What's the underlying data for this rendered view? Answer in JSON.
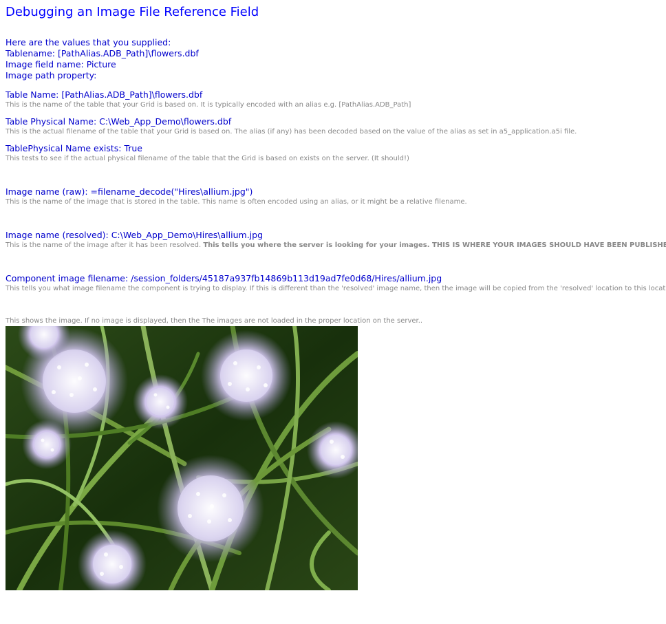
{
  "page": {
    "title": "Debugging an Image File Reference Field"
  },
  "supplied": {
    "intro": "Here are the values that you supplied:",
    "tablename": "Tablename: [PathAlias.ADB_Path]\\flowers.dbf",
    "image_field": "Image field name: Picture",
    "image_path_property": "Image path property:"
  },
  "table_name": {
    "label": "Table Name: [PathAlias.ADB_Path]\\flowers.dbf",
    "note": "This is the name of the table that your Grid is based on. It is typically encoded with an alias e.g. [PathAlias.ADB_Path]"
  },
  "table_physical_name": {
    "label": "Table Physical Name: C:\\Web_App_Demo\\flowers.dbf",
    "note": "This is the actual filename of the table that your Grid is based on. The alias (if any) has been decoded based on the value of the alias as set in a5_application.a5i file."
  },
  "physical_exists": {
    "label": "TablePhysical Name exists: True",
    "note": "This tests to see if the actual physical filename of the table that the Grid is based on exists on the server. (It should!)"
  },
  "image_raw": {
    "label": "Image name (raw): =filename_decode(\"Hires\\allium.jpg\")",
    "note": "This is the name of the image that is stored in the table. This name is often encoded using an alias, or it might be a relative filename."
  },
  "image_resolved": {
    "label": "Image name (resolved): C:\\Web_App_Demo\\Hires\\allium.jpg",
    "note_plain": "This is the name of the image after it has been resolved. ",
    "note_bold": "This tells you where the server is looking for your images. THIS IS WHERE YOUR IMAGES SHOULD HAVE BEEN PUBLISHED.."
  },
  "component_image": {
    "label": "Component image filename: /session_folders/45187a937fb14869b113d19ad7fe0d68/Hires/allium.jpg",
    "note": "This tells you what image filename the component is trying to display. If this is different than the 'resolved' image name, then the image will be copied from the 'resolved' location to this location.."
  },
  "image_display": {
    "note": "This shows the image. If no image is displayed, then the The images are not loaded in the proper location on the server..",
    "image_name": "allium-flower-photo"
  },
  "colors": {
    "title": "#0000ff",
    "label": "#0000cc",
    "note": "#888888"
  }
}
